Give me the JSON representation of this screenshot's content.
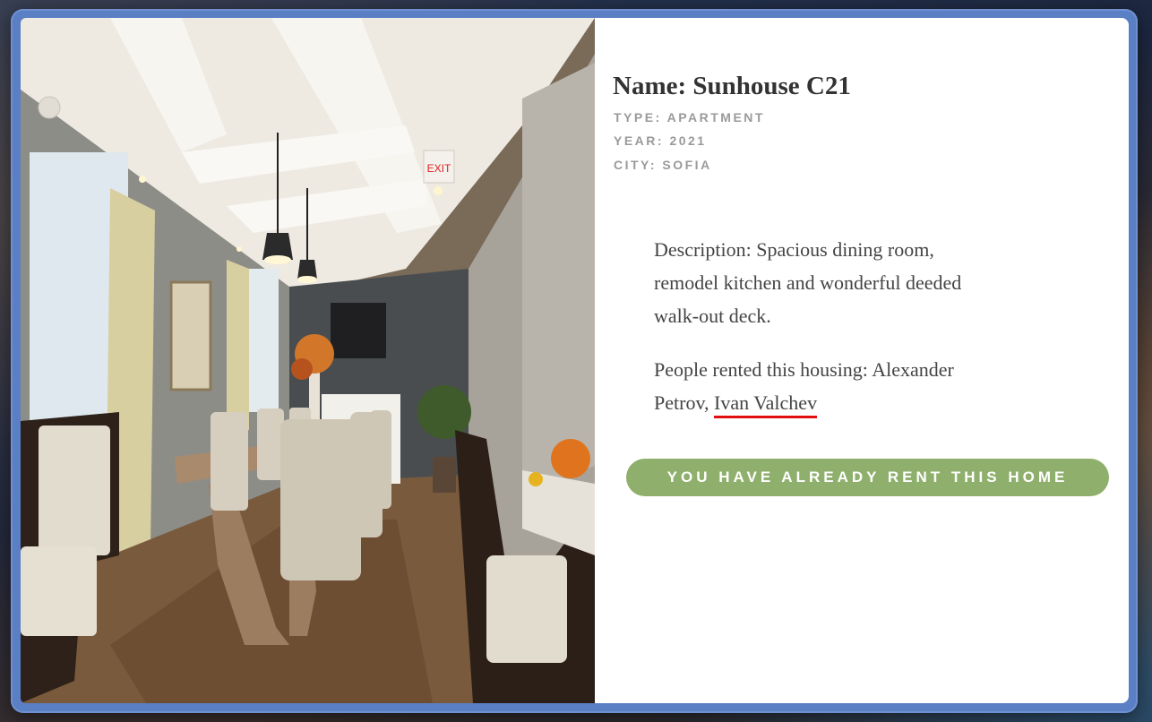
{
  "listing": {
    "name_label": "Name: Sunhouse C21",
    "type_label": "TYPE: APARTMENT",
    "year_label": "YEAR: 2021",
    "city_label": "CITY: SOFIA",
    "description": "Description: Spacious dining room, remodel kitchen and wonderful deeded walk-out deck.",
    "renters_prefix": "People rented this housing: ",
    "renters": [
      {
        "name": "Alexander Petrov",
        "separator": ", "
      },
      {
        "name": "Ivan Valchev",
        "separator": ""
      }
    ]
  },
  "actions": {
    "rent_button_label": "YOU HAVE ALREADY RENT THIS HOME"
  },
  "photo": {
    "subject": "dining room interior",
    "exit_sign_text": "EXIT"
  },
  "colors": {
    "frame": "#5b7fc4",
    "button": "#8faf6c",
    "underline": "#e01010",
    "title": "#333333",
    "meta": "#9a9a9a"
  }
}
